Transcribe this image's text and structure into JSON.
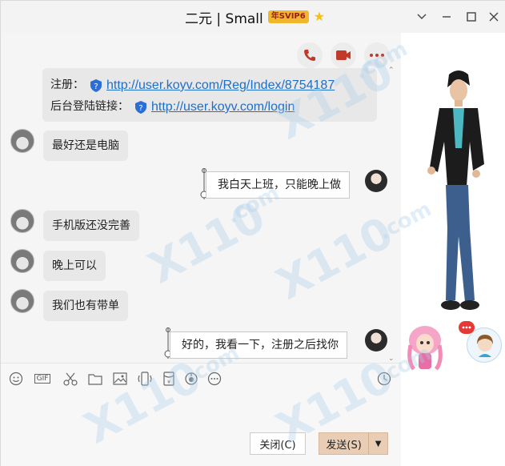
{
  "window": {
    "title": "二元 | Small",
    "vip_badge": "年SVIP6",
    "controls": [
      "chevron-down-icon",
      "minimize-icon",
      "maximize-icon",
      "close-icon"
    ]
  },
  "chat_toolbar": {
    "buttons": [
      "phone-icon",
      "video-icon",
      "more-icon"
    ]
  },
  "messages": [
    {
      "side": "left",
      "type": "links",
      "lines": [
        {
          "label": "注册：",
          "link": "http://user.koyv.com/Reg/Index/8754187"
        },
        {
          "label": "后台登陆链接：",
          "link": "http://user.koyv.com/login"
        }
      ]
    },
    {
      "side": "left",
      "text": "最好还是电脑"
    },
    {
      "side": "right",
      "text": "我白天上班，只能晚上做"
    },
    {
      "side": "left",
      "text": "手机版还没完善"
    },
    {
      "side": "left",
      "text": "晚上可以"
    },
    {
      "side": "left",
      "text": "我们也有带单"
    },
    {
      "side": "right",
      "text": "好的，我看一下，注册之后找你"
    }
  ],
  "input_toolbar": {
    "tools": [
      "emoji-icon",
      "gif-icon",
      "scissors-icon",
      "folder-icon",
      "image-icon",
      "shake-icon",
      "red-packet-icon",
      "voice-icon",
      "more-icon",
      "history-icon"
    ],
    "gif_label": "GIF"
  },
  "actions": {
    "close_label": "关闭(C)",
    "send_label": "发送(S)"
  },
  "watermark": {
    "brand": "X110",
    "domain": ".com"
  },
  "colors": {
    "link": "#1e6fc9",
    "send_bg": "#e9cdb5",
    "vip_badge": "#f0b72c",
    "bubble_left": "#e8e8e8"
  }
}
